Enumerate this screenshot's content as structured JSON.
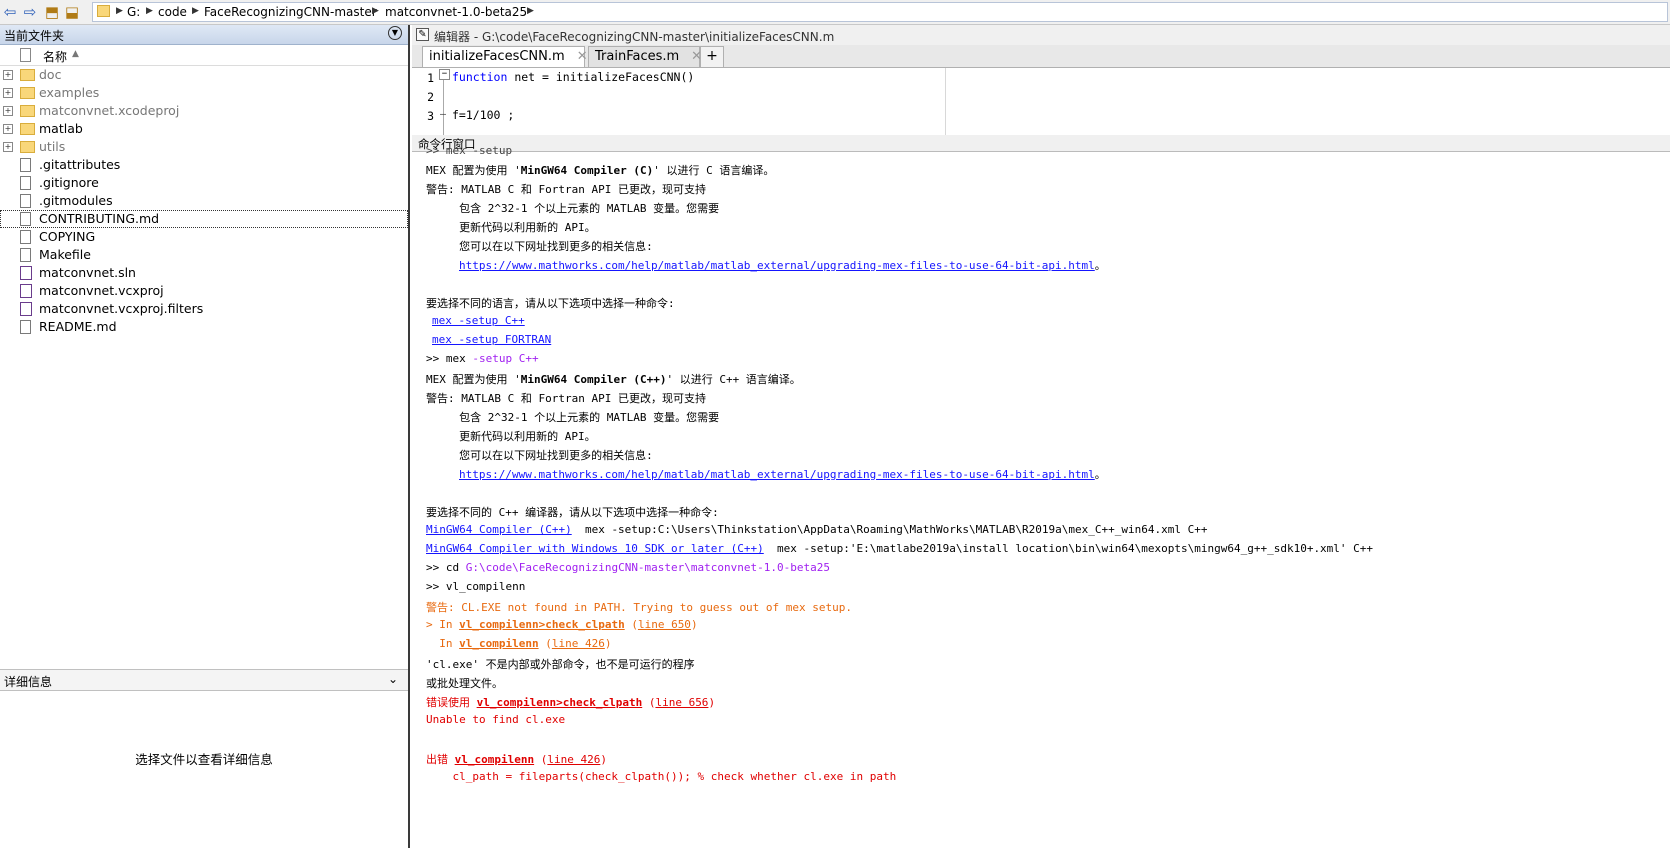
{
  "address": {
    "crumbs": [
      "G:",
      "code",
      "FaceRecognizingCNN-master",
      "matconvnet-1.0-beta25"
    ]
  },
  "file_panel": {
    "title": "当前文件夹",
    "column_name": "名称",
    "items": [
      {
        "name": "doc",
        "type": "folder"
      },
      {
        "name": "examples",
        "type": "folder"
      },
      {
        "name": "matconvnet.xcodeproj",
        "type": "folder"
      },
      {
        "name": "matlab",
        "type": "folder"
      },
      {
        "name": "utils",
        "type": "folder"
      },
      {
        "name": ".gitattributes",
        "type": "file"
      },
      {
        "name": ".gitignore",
        "type": "file"
      },
      {
        "name": ".gitmodules",
        "type": "file"
      },
      {
        "name": "CONTRIBUTING.md",
        "type": "file"
      },
      {
        "name": "COPYING",
        "type": "file"
      },
      {
        "name": "Makefile",
        "type": "file"
      },
      {
        "name": "matconvnet.sln",
        "type": "file"
      },
      {
        "name": "matconvnet.vcxproj",
        "type": "file"
      },
      {
        "name": "matconvnet.vcxproj.filters",
        "type": "file"
      },
      {
        "name": "README.md",
        "type": "file"
      }
    ]
  },
  "detail_panel": {
    "title": "详细信息",
    "empty_text": "选择文件以查看详细信息"
  },
  "editor": {
    "title": "编辑器 - G:\\code\\FaceRecognizingCNN-master\\initializeFacesCNN.m",
    "tabs": [
      "initializeFacesCNN.m",
      "TrainFaces.m"
    ],
    "add_tab": "+",
    "close_glyph": "✕",
    "lines": [
      {
        "num": "1",
        "text": "function net = initializeFacesCNN()",
        "kw": "function",
        "rest": " net = initializeFacesCNN()"
      },
      {
        "num": "2",
        "text": ""
      },
      {
        "num": "3",
        "text": "f=1/100 ;",
        "marker": "–"
      }
    ]
  },
  "command_window": {
    "title": "命令行窗口",
    "lines": {
      "l0": ">> mex -setup",
      "l1a": "MEX 配置为使用 '",
      "l1b": "MinGW64 Compiler (C)",
      "l1c": "' 以进行 C 语言编译。",
      "l2": "警告: MATLAB C 和 Fortran API 已更改，现可支持",
      "l3": "     包含 2^32-1 个以上元素的 MATLAB 变量。您需要",
      "l4": "     更新代码以利用新的 API。",
      "l5": "     您可以在以下网址找到更多的相关信息:",
      "l6": "https://www.mathworks.com/help/matlab/matlab_external/upgrading-mex-files-to-use-64-bit-api.html",
      "l6s": "。",
      "l7": "要选择不同的语言，请从以下选项中选择一种命令:",
      "l8": "mex -setup C++",
      "l9": "mex -setup FORTRAN",
      "l10a": ">> mex ",
      "l10b": "-setup C++",
      "l11a": "MEX 配置为使用 '",
      "l11b": "MinGW64 Compiler (C++)",
      "l11c": "' 以进行 C++ 语言编译。",
      "l12": "警告: MATLAB C 和 Fortran API 已更改，现可支持",
      "l13": "     包含 2^32-1 个以上元素的 MATLAB 变量。您需要",
      "l14": "     更新代码以利用新的 API。",
      "l15": "     您可以在以下网址找到更多的相关信息:",
      "l16": "https://www.mathworks.com/help/matlab/matlab_external/upgrading-mex-files-to-use-64-bit-api.html",
      "l16s": "。",
      "l17": "要选择不同的 C++ 编译器，请从以下选项中选择一种命令:",
      "l18a": "MinGW64 Compiler (C++)",
      "l18b": "  mex -setup:C:\\Users\\Thinkstation\\AppData\\Roaming\\MathWorks\\MATLAB\\R2019a\\mex_C++_win64.xml C++",
      "l19a": "MinGW64 Compiler with Windows 10 SDK or later (C++)",
      "l19b": "  mex -setup:'E:\\matlabe2019a\\install location\\bin\\win64\\mexopts\\mingw64_g++_sdk10+.xml' C++",
      "l20a": ">> cd ",
      "l20b": "G:\\code\\FaceRecognizingCNN-master\\matconvnet-1.0-beta25",
      "l21": ">> vl_compilenn",
      "l22": "警告: CL.EXE not found in PATH. Trying to guess out of mex setup.",
      "l23a": "> In ",
      "l23b": "vl_compilenn>check_clpath",
      "l23c": " (",
      "l23d": "line 650",
      "l23e": ")",
      "l24a": "  In ",
      "l24b": "vl_compilenn",
      "l24c": " (",
      "l24d": "line 426",
      "l24e": ")",
      "l25": "'cl.exe' 不是内部或外部命令，也不是可运行的程序",
      "l26": "或批处理文件。",
      "l27a": "错误使用 ",
      "l27b": "vl_compilenn>check_clpath",
      "l27c": " (",
      "l27d": "line 656",
      "l27e": ")",
      "l28": "Unable to find cl.exe",
      "l29a": "出错 ",
      "l29b": "vl_compilenn",
      "l29c": " (",
      "l29d": "line 426",
      "l29e": ")",
      "l30": "    cl_path = fileparts(check_clpath()); % check whether cl.exe in path"
    }
  }
}
